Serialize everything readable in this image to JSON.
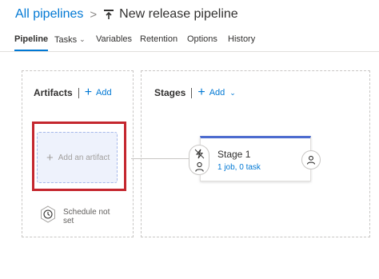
{
  "header": {
    "breadcrumb_link": "All pipelines",
    "separator": ">",
    "pipeline_icon": "release-pipeline-icon",
    "title": "New release pipeline"
  },
  "tabs": [
    {
      "label": "Pipeline",
      "active": true
    },
    {
      "label": "Tasks",
      "has_dropdown": true
    },
    {
      "label": "Variables"
    },
    {
      "label": "Retention"
    },
    {
      "label": "Options"
    },
    {
      "label": "History"
    }
  ],
  "artifacts": {
    "title": "Artifacts",
    "add_label": "Add",
    "add_card_label": "Add an artifact",
    "schedule_label": "Schedule not set"
  },
  "stages": {
    "title": "Stages",
    "add_label": "Add",
    "stage": {
      "name": "Stage 1",
      "summary": "1 job, 0 task"
    }
  },
  "colors": {
    "accent": "#0078d4",
    "stage_bar": "#4d6ccf",
    "highlight": "#c4262e",
    "artifact_card_bg": "#eef2fc"
  }
}
